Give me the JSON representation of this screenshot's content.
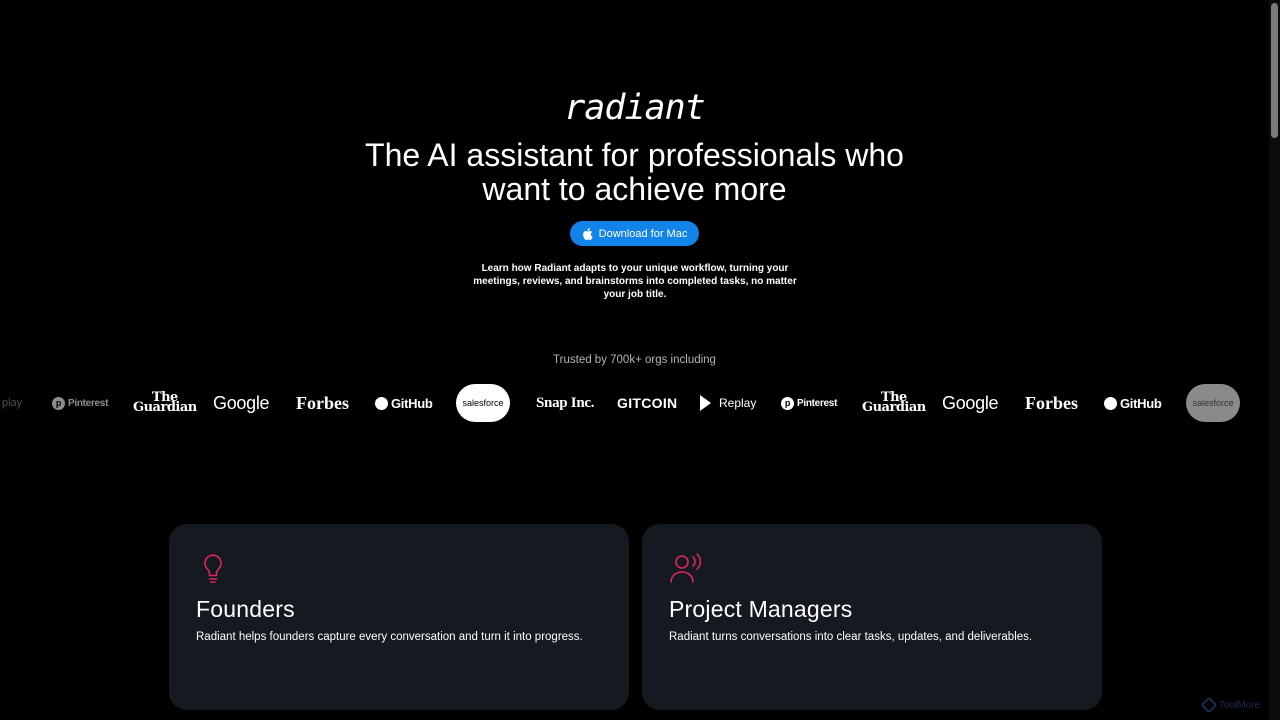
{
  "hero": {
    "logo": "radiant",
    "headline_line1": "The AI assistant for professionals who",
    "headline_line2": "want to achieve more",
    "cta_label": "Download for Mac",
    "cta_icon": "apple-icon",
    "lede": "Learn how Radiant adapts to your unique workflow, turning your meetings, reviews, and brainstorms into completed tasks, no matter your job title.",
    "accent_color": "#1283e8"
  },
  "trusted": {
    "heading": "Trusted by 700k+ orgs including",
    "logos": [
      {
        "name": "Replay",
        "text": "Replay",
        "partial": "play"
      },
      {
        "name": "Pinterest",
        "text": "Pinterest"
      },
      {
        "name": "The Guardian",
        "line1": "The",
        "line2": "Guardian"
      },
      {
        "name": "Google",
        "text": "Google"
      },
      {
        "name": "Forbes",
        "text": "Forbes"
      },
      {
        "name": "GitHub",
        "text": "GitHub"
      },
      {
        "name": "Salesforce",
        "text": "salesforce"
      },
      {
        "name": "Snap Inc.",
        "text": "Snap Inc."
      },
      {
        "name": "Gitcoin",
        "text": "GITCOIN"
      },
      {
        "name": "Replay",
        "text": "Replay"
      },
      {
        "name": "Pinterest",
        "text": "Pinterest"
      },
      {
        "name": "The Guardian",
        "line1": "The",
        "line2": "Guardian"
      },
      {
        "name": "Google",
        "text": "Google"
      },
      {
        "name": "Forbes",
        "text": "Forbes"
      },
      {
        "name": "GitHub",
        "text": "GitHub"
      },
      {
        "name": "Salesforce",
        "text": "salesforce"
      }
    ]
  },
  "cards": [
    {
      "icon": "lightbulb-icon",
      "title": "Founders",
      "text": "Radiant helps founders capture every conversation and turn it into progress."
    },
    {
      "icon": "person-speaking-icon",
      "title": "Project Managers",
      "text": "Radiant turns conversations into clear tasks, updates, and deliverables."
    }
  ],
  "icon_color": "#e0245e",
  "card_background": "#151a20",
  "watermark": "ToolMore"
}
